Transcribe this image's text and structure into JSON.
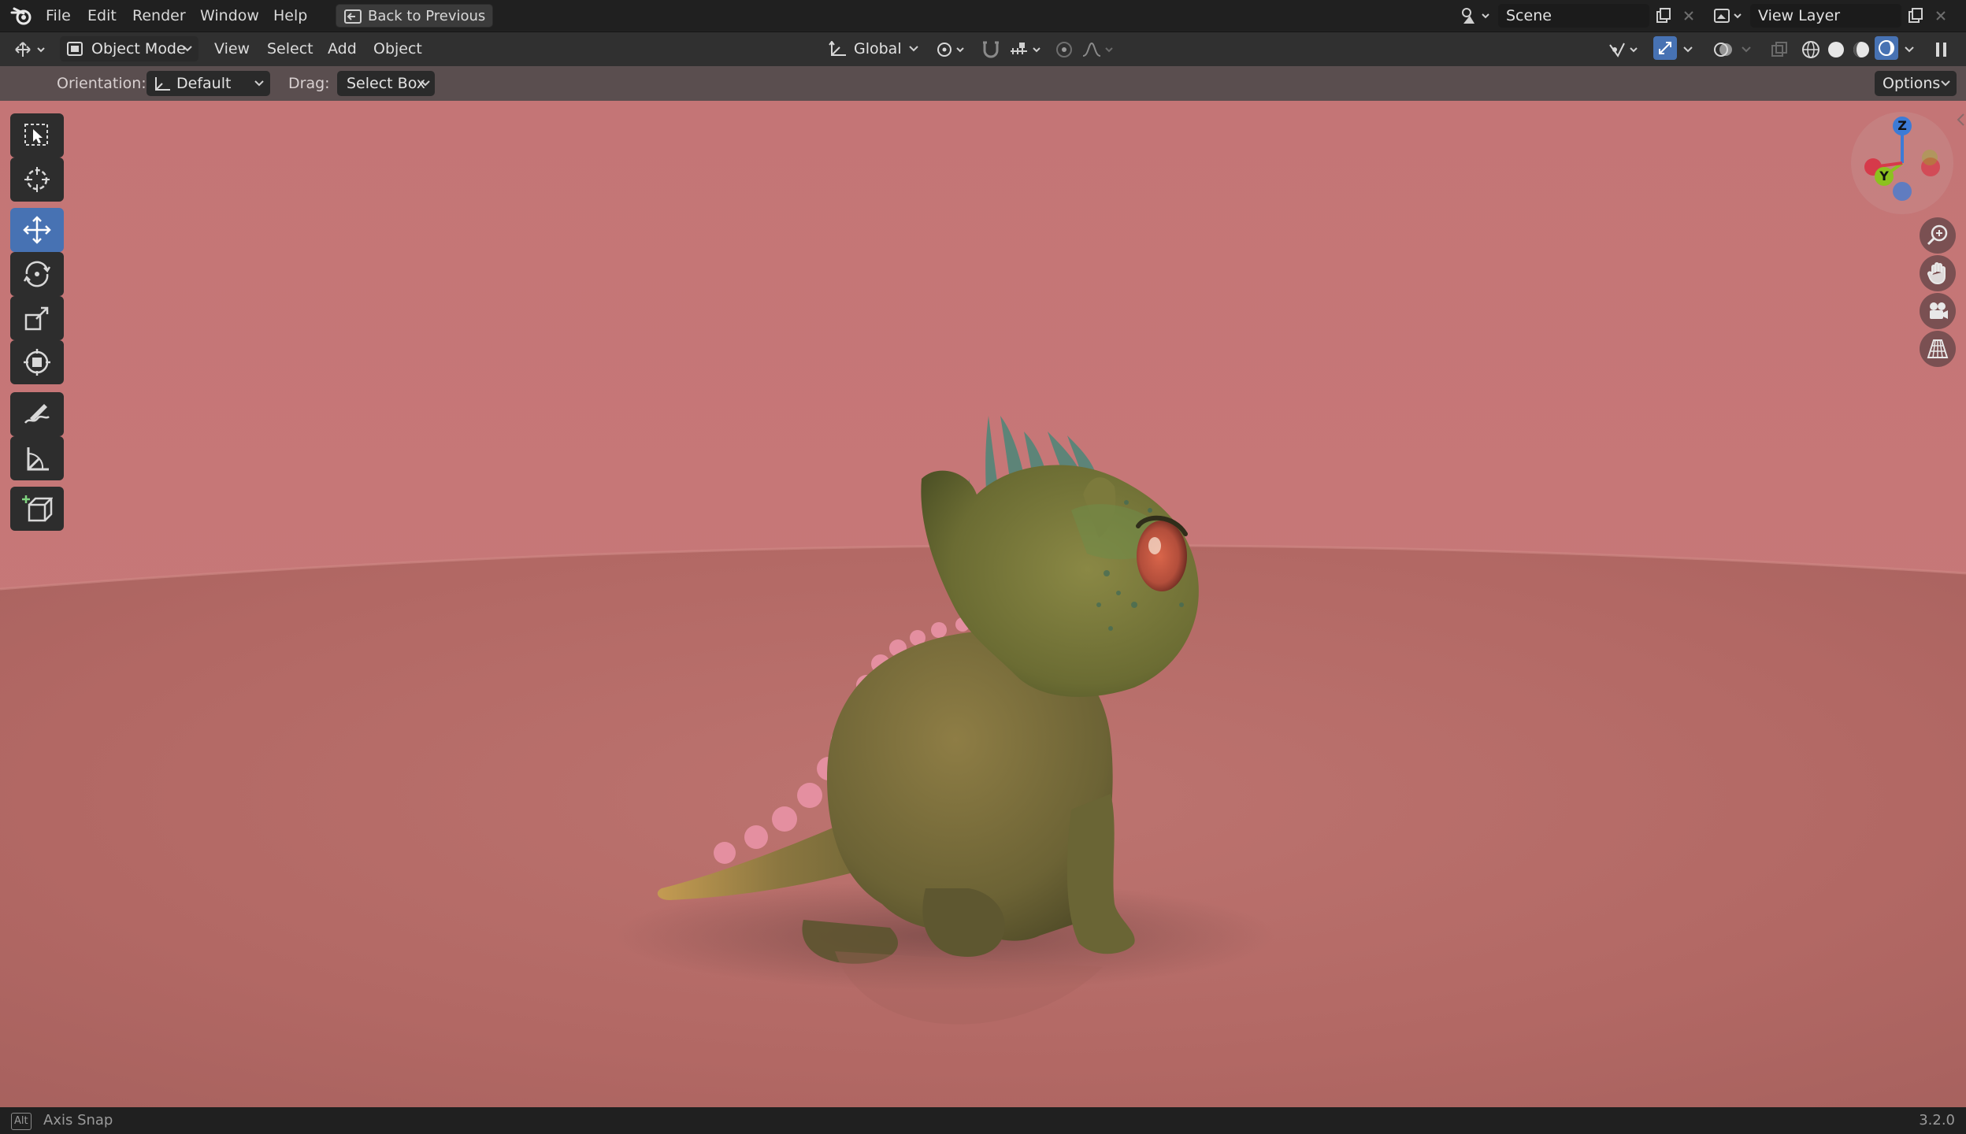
{
  "menu": {
    "items": [
      "File",
      "Edit",
      "Render",
      "Window",
      "Help"
    ],
    "back_button": "Back to Previous"
  },
  "scene": {
    "label": "Scene",
    "view_layer": "View Layer"
  },
  "header": {
    "mode": "Object Mode",
    "menus": [
      "View",
      "Select",
      "Add",
      "Object"
    ],
    "transform_orientation": "Global"
  },
  "tool_settings": {
    "orientation_label": "Orientation:",
    "orientation_value": "Default",
    "drag_label": "Drag:",
    "drag_value": "Select Box",
    "options": "Options"
  },
  "gizmo": {
    "z": "Z",
    "y": "Y"
  },
  "toolbar": {
    "tools": [
      "select-box",
      "cursor",
      "move",
      "rotate",
      "scale",
      "transform",
      "annotate",
      "measure",
      "add-cube"
    ],
    "active_tool": "move"
  },
  "status": {
    "key": "Alt",
    "hint": "Axis Snap",
    "version": "3.2.0"
  },
  "colors": {
    "accent": "#4772b3",
    "background_wall": "#c27574",
    "floor": "#b56a68",
    "gizmo_x": "#d63a4a",
    "gizmo_y": "#8cc11f",
    "gizmo_z": "#3d7bd6"
  }
}
